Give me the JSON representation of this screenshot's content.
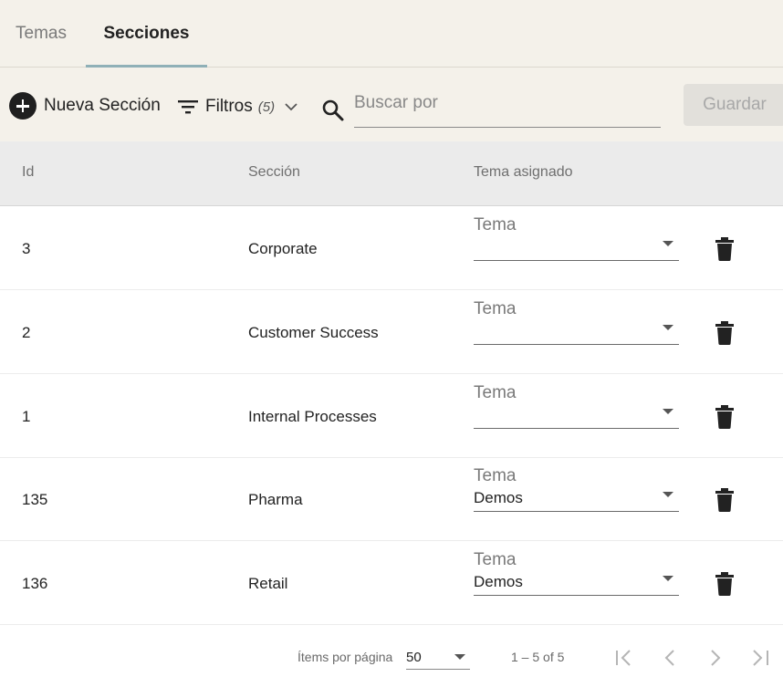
{
  "tabs": [
    {
      "label": "Temas",
      "active": false
    },
    {
      "label": "Secciones",
      "active": true
    }
  ],
  "toolbar": {
    "add_label": "Nueva Sección",
    "filter_label": "Filtros",
    "filter_count": "(5)",
    "search_placeholder": "Buscar por",
    "search_value": "",
    "save_label": "Guardar"
  },
  "table": {
    "headers": {
      "id": "Id",
      "section": "Sección",
      "theme": "Tema asignado"
    },
    "theme_field_label": "Tema",
    "rows": [
      {
        "id": "3",
        "section": "Corporate",
        "theme": ""
      },
      {
        "id": "2",
        "section": "Customer Success",
        "theme": ""
      },
      {
        "id": "1",
        "section": "Internal Processes",
        "theme": ""
      },
      {
        "id": "135",
        "section": "Pharma",
        "theme": "Demos"
      },
      {
        "id": "136",
        "section": "Retail",
        "theme": "Demos"
      }
    ]
  },
  "pagination": {
    "items_label": "Ítems por página",
    "page_size": "50",
    "range": "1 – 5 of 5"
  },
  "colors": {
    "header_bg": "#f4f1ea",
    "tab_indicator": "#8fb0b7",
    "table_header_bg": "#ebebeb",
    "save_disabled_bg": "#e2e0db"
  }
}
